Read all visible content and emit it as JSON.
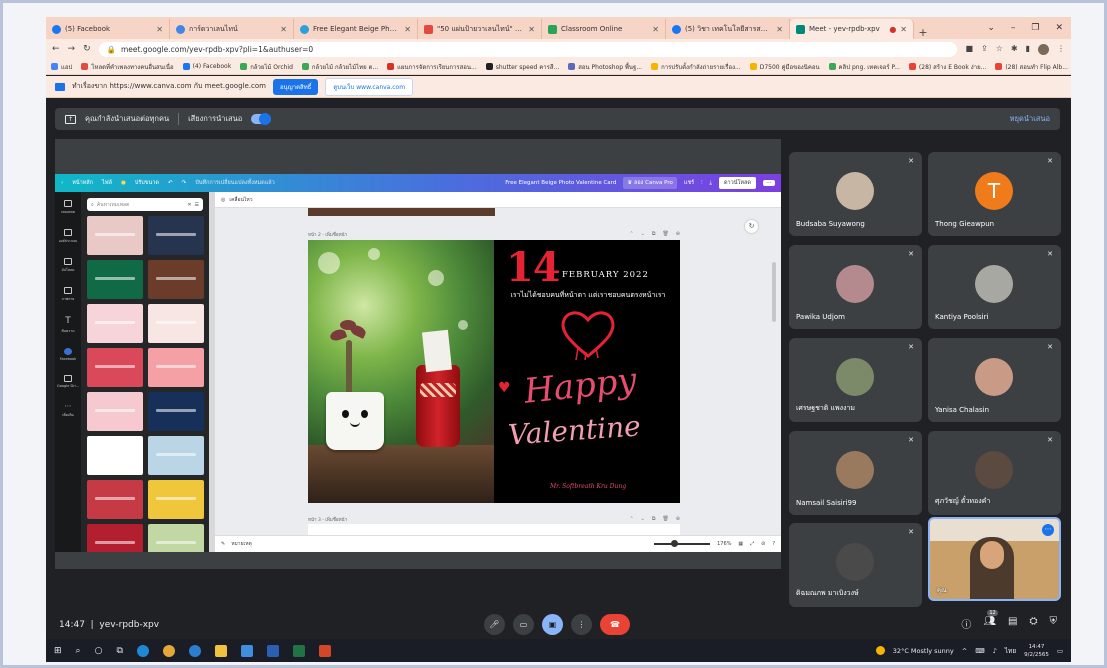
{
  "tabs": [
    {
      "title": "(5) Facebook",
      "color": "#1877f2"
    },
    {
      "title": "การ์ดวาเลนไทน์",
      "color": "#3f88e6"
    },
    {
      "title": "Free Elegant Beige Photo V",
      "color": "#2aa1d9"
    },
    {
      "title": "\"50 แผ่นป้ายวาเลนไทน์\" ดาวโหลดฟรีแม่",
      "color": "#e04a3f"
    },
    {
      "title": "Classroom Online",
      "color": "#29a35a"
    },
    {
      "title": "(5) วิชา เทคโนโลยีสารสนเทศ 2 ป.6",
      "color": "#1877f2"
    },
    {
      "title": "Meet - yev-rpdb-xpv",
      "color": "#00897b"
    }
  ],
  "address": {
    "url": "meet.google.com/yev-rpdb-xpv?pli=1&authuser=0"
  },
  "bookmarks": [
    {
      "label": "แอป",
      "color": "#4285f4"
    },
    {
      "label": "โหลดที่คำเพลงทางคนอื่นสนเนื่อ",
      "color": "#e04a3f"
    },
    {
      "label": "(4) Facebook",
      "color": "#1877f2"
    },
    {
      "label": "กล้วยไม้ Orchid",
      "color": "#3aa857"
    },
    {
      "label": "กล้วยไม้ กล้วยไม้ไทย ต...",
      "color": "#3aa857"
    },
    {
      "label": "แผนการจัดการเรียนการสอน...",
      "color": "#d93025"
    },
    {
      "label": "shutter speed คารสี...",
      "color": "#202124"
    },
    {
      "label": "สอน Photoshop พื้นฐ...",
      "color": "#5b6abf"
    },
    {
      "label": "การปรับตั้งกำลังถ่ายรายเรื่อง...",
      "color": "#f6b400"
    },
    {
      "label": "D7500 คู่มือของนิคอน",
      "color": "#f6b400"
    },
    {
      "label": "คลิป png. เทคเจอร์ P...",
      "color": "#3aa857"
    },
    {
      "label": "(28) สร้าง E Book ง่าย...",
      "color": "#ea4335"
    },
    {
      "label": "(28) สอนทำ Flip Alb...",
      "color": "#ea4335"
    }
  ],
  "notification": {
    "text": "ทำเรื่องขาก https://www.canva.com กับ meet.google.com",
    "allow_label": "อนุญาตสิทธิ์",
    "open_label": "ดูบนเว็บ www.canva.com"
  },
  "presenting_bar": {
    "label": "คุณกำลังนำเสนอต่อทุกคน",
    "audio_label": "เสียงการนำเสนอ",
    "stop_label": "หยุดนำเสนอ"
  },
  "canva": {
    "top_left": [
      "หน้าหลัก",
      "ไฟล์",
      "ปรับขนาด"
    ],
    "saved_label": "บันทึกการเปลี่ยนแปลงทั้งหมดแล้ว",
    "doc_title": "Free Elegant Beige Photo Valentine Card",
    "pro_label": "ลอง Canva Pro",
    "share_label": "แชร์",
    "download_label": "ดาวน์โหลด",
    "rail": [
      "เทมเพลต",
      "องค์ประกอบ",
      "อัปโหลด",
      "ภาพถ่าย",
      "ข้อความ",
      "Facebook",
      "Google Dri...",
      "เพิ่มเติม"
    ],
    "search_placeholder": "ค้นหาเทมเพลต",
    "animate_label": "เคลื่อนไหว",
    "page_label": "หน้า 2 - เพิ่มชื่อหน้า",
    "page3_label": "หน้า 3 - เพิ่มชื่อหน้า",
    "notes_label": "หมายเหตุ",
    "zoom": "176%",
    "card": {
      "day": "14",
      "month_year": "FEBRUARY 2022",
      "thai_line": "เราไม่ได้ชอบคนที่หน้าตา แต่เราชอบคนตรงหน้าเรา",
      "happy": "Happy",
      "valentine": "Valentine",
      "signature": "Mr. Softbreath Kru Dung"
    },
    "thumbs": [
      "#e9c9c5",
      "#26344f",
      "#0f6a45",
      "#6b3c2a",
      "#f6d4d9",
      "#f7e6e3",
      "#d9495a",
      "#f4a0a5",
      "#f6c9d0",
      "#16305a",
      "#ffffff",
      "#b9d5e6",
      "#c63a45",
      "#f0c73a",
      "#b31f2e",
      "#c2d8a2"
    ]
  },
  "participants": [
    {
      "name": "Budsaba Suyawong"
    },
    {
      "name": "Thong Gieawpun",
      "initial": "T"
    },
    {
      "name": "Pawika Udjom"
    },
    {
      "name": "Kantiya Poolsiri"
    },
    {
      "name": "เศรษฐชาติ แพงงาม"
    },
    {
      "name": "Yanisa Chalasin"
    },
    {
      "name": "Namsail Saisiri99"
    },
    {
      "name": "ศุภวัชญ์ ตั๋วทองคำ"
    },
    {
      "name": "ดิฉมณภพ มาเบิงวงษ์"
    },
    {
      "name": "คุณ"
    }
  ],
  "meet_bar": {
    "time": "14:47",
    "meeting_code": "yev-rpdb-xpv",
    "participant_count": "12"
  },
  "taskbar": {
    "weather": "32°C Mostly sunny",
    "lang": "ไทย",
    "time": "14:47",
    "date": "9/2/2565"
  }
}
